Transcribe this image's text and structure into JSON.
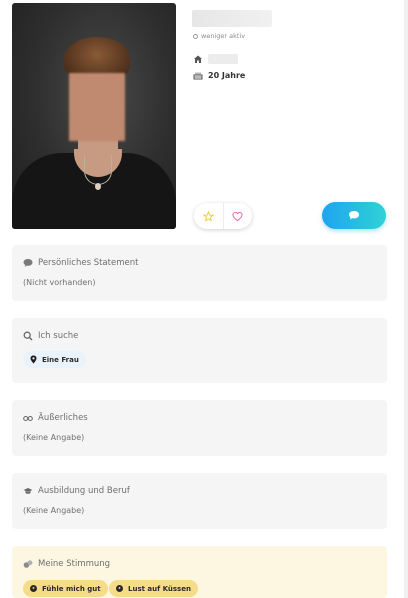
{
  "profile": {
    "status": "weniger aktiv",
    "age": "20 Jahre"
  },
  "sections": {
    "statement": {
      "title": "Persönliches Statement",
      "value": "(Nicht vorhanden)"
    },
    "search": {
      "title": "Ich suche",
      "chip": "Eine Frau"
    },
    "appearance": {
      "title": "Äußerliches",
      "value": "(Keine Angabe)"
    },
    "education": {
      "title": "Ausbildung und Beruf",
      "value": "(Keine Angabe)"
    },
    "mood": {
      "title": "Meine Stimmung",
      "chips": [
        "Fühle mich gut",
        "Lust auf Küssen"
      ]
    }
  },
  "colors": {
    "accent_gradient_start": "#1fa4ee",
    "accent_gradient_end": "#2ed3d6",
    "star": "#e8c93a",
    "heart": "#e86aa6",
    "mood_background": "#fdf7e1"
  },
  "icons": {
    "status": "status-ring-icon",
    "home": "home-icon",
    "age": "cake-icon",
    "favorite": "star-icon",
    "like": "heart-icon",
    "message": "chat-bubble-icon",
    "statement": "speech-bubble-icon",
    "search": "magnifier-icon",
    "search_chip": "location-pin-icon",
    "appearance": "glasses-icon",
    "education": "graduation-cap-icon",
    "mood": "mood-icon",
    "mood_chip_1": "smile-icon",
    "mood_chip_2": "kiss-icon"
  }
}
